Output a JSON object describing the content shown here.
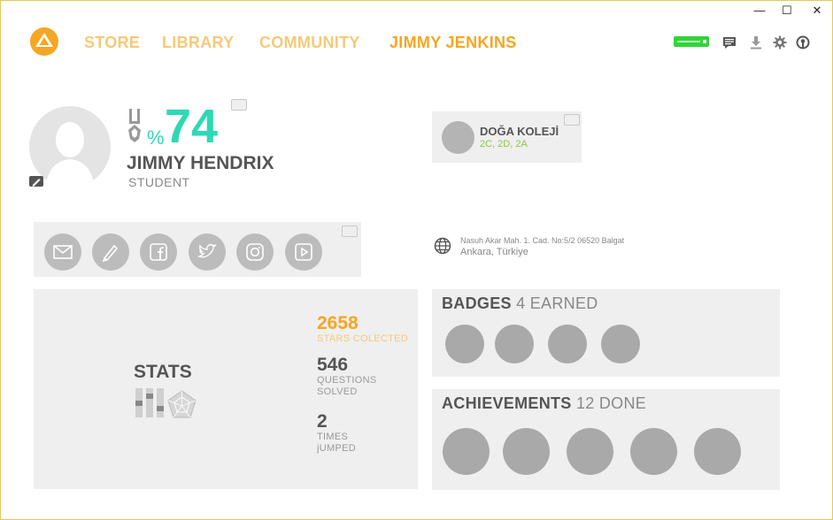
{
  "window": {
    "minimize": "—",
    "maximize": "☐",
    "close": "✕"
  },
  "nav": {
    "items": [
      {
        "label": "STORE"
      },
      {
        "label": "LIBRARY"
      },
      {
        "label": "COMMUNITY"
      },
      {
        "label": "JIMMY JENKINS"
      }
    ]
  },
  "toolbar_icons": [
    "status-indicator",
    "chat-icon",
    "download-icon",
    "settings-icon",
    "support-icon"
  ],
  "profile": {
    "percent_sign": "%",
    "percent": "74",
    "name": "JIMMY HENDRIX",
    "role": "STUDENT"
  },
  "school": {
    "name": "DOĞA KOLEJİ",
    "classes": "2C, 2D, 2A"
  },
  "socials": [
    "mail-icon",
    "pencil-icon",
    "facebook-icon",
    "twitter-icon",
    "instagram-icon",
    "youtube-icon"
  ],
  "address": {
    "line1": "Nasuh Akar Mah. 1. Cad. No:5/2 06520 Balgat",
    "line2": "Ankara, Türkiye"
  },
  "stats": {
    "title": "STATS",
    "items": [
      {
        "value": "2658",
        "label1": "STARS COLECTED",
        "label2": "",
        "color": "#f5a623"
      },
      {
        "value": "546",
        "label1": "QUESTIONS",
        "label2": "SOLVED",
        "color": "#555555"
      },
      {
        "value": "2",
        "label1": "TIMES",
        "label2": "jUMPED",
        "color": "#555555"
      }
    ]
  },
  "badges": {
    "title": "BADGES",
    "subtitle": "4 EARNED",
    "count": 4
  },
  "achievements": {
    "title": "ACHIEVEMENTS",
    "subtitle": "12 DONE",
    "count": 5
  },
  "colors": {
    "accent": "#f5a623",
    "accent_light": "#f6c978",
    "teal": "#2fd8b5",
    "green": "#8cc63f",
    "online": "#32d43a"
  }
}
